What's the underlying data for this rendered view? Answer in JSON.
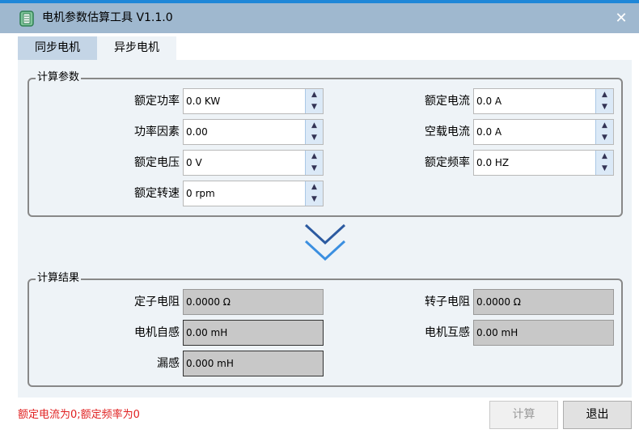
{
  "window": {
    "title": "电机参数估算工具 V1.1.0",
    "close_symbol": "✕"
  },
  "tabs": [
    {
      "label": "同步电机",
      "active": false
    },
    {
      "label": "异步电机",
      "active": true
    }
  ],
  "input_group": {
    "title": "计算参数",
    "fields": [
      {
        "label": "额定功率",
        "value": "0.0 KW"
      },
      {
        "label": "功率因素",
        "value": "0.00"
      },
      {
        "label": "额定电压",
        "value": "0 V"
      },
      {
        "label": "额定转速",
        "value": "0 rpm"
      },
      {
        "label": "额定电流",
        "value": "0.0 A"
      },
      {
        "label": "空载电流",
        "value": "0.0 A"
      },
      {
        "label": "额定频率",
        "value": "0.0 HZ"
      }
    ]
  },
  "result_group": {
    "title": "计算结果",
    "fields": [
      {
        "label": "定子电阻",
        "value": "0.0000 Ω"
      },
      {
        "label": "电机自感",
        "value": "0.00 mH"
      },
      {
        "label": "漏感",
        "value": "0.000 mH"
      },
      {
        "label": "转子电阻",
        "value": "0.0000 Ω"
      },
      {
        "label": "电机互感",
        "value": "0.00 mH"
      }
    ]
  },
  "status_message": "额定电流为0;额定频率为0",
  "buttons": {
    "calculate": "计算",
    "exit": "退出"
  },
  "colors": {
    "accent": "#1f87d8",
    "titlebar": "#9fb8cf",
    "error_text": "#e02020",
    "panel": "#eef3f7"
  }
}
